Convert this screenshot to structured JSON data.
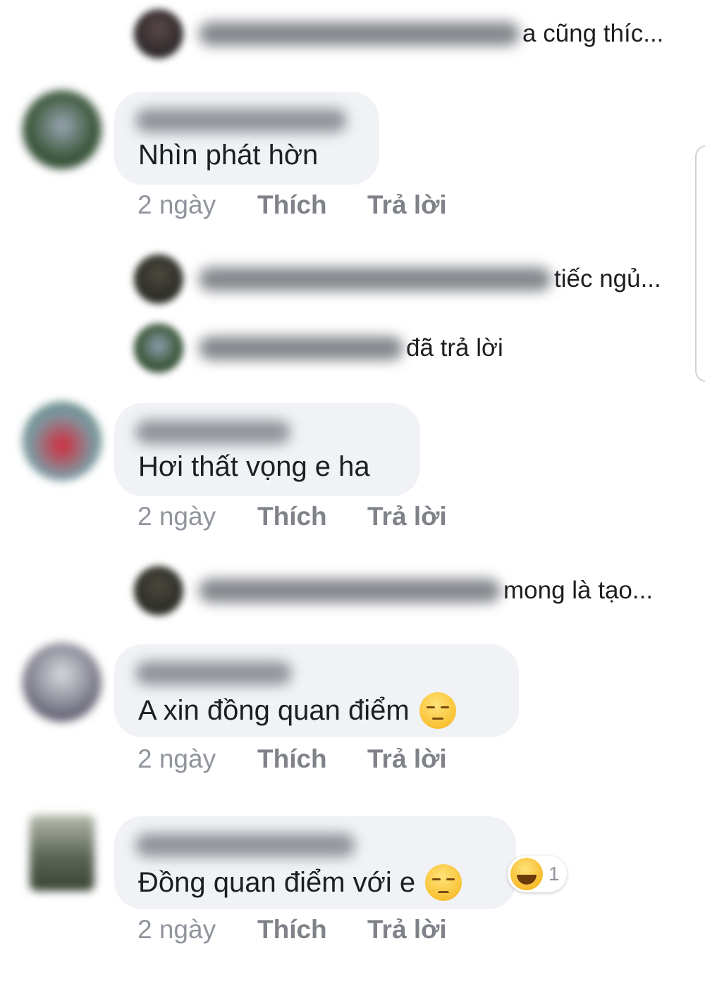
{
  "replies": [
    {
      "text": "a cũng thíc..."
    },
    {
      "text": "tiếc ngủ..."
    },
    {
      "text": "đã trả lời"
    },
    {
      "text": "mong là tạo..."
    }
  ],
  "comments": [
    {
      "text": "Nhìn phát hờn",
      "time": "2 ngày",
      "like": "Thích",
      "reply": "Trả lời"
    },
    {
      "text": "Hơi thất vọng e ha",
      "time": "2 ngày",
      "like": "Thích",
      "reply": "Trả lời"
    },
    {
      "text": "A xin đồng quan điểm",
      "emoji": "pensive-face",
      "time": "2 ngày",
      "like": "Thích",
      "reply": "Trả lời"
    },
    {
      "text": "Đồng quan điểm với e",
      "emoji": "disappointed-face",
      "time": "2 ngày",
      "like": "Thích",
      "reply": "Trả lời",
      "reaction": {
        "icon": "haha-reaction",
        "count": "1"
      }
    }
  ],
  "colors": {
    "bubble": "#f0f2f5",
    "meta_text": "#90949c",
    "action_text": "#7f8288",
    "body_text": "#1c1e21"
  }
}
